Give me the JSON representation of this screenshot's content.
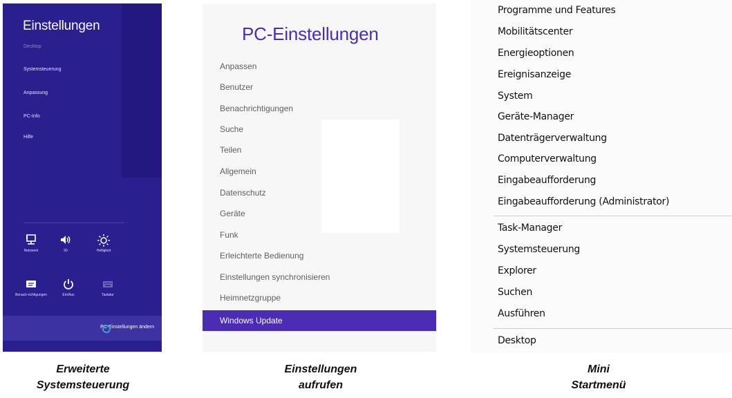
{
  "panel1": {
    "title": "Einstellungen",
    "subtitle": "Desktop",
    "items": [
      "Systemsteuerung",
      "Anpassung",
      "PC-Info",
      "Hilfe"
    ],
    "tiles": [
      {
        "icon": "network-icon",
        "label": "Netzwerk"
      },
      {
        "icon": "volume-icon",
        "label": "50"
      },
      {
        "icon": "brightness-icon",
        "label": "Helligkeit"
      },
      {
        "icon": "notifications-icon",
        "label": "Benach-richtigungen"
      },
      {
        "icon": "power-icon",
        "label": "Ein/Aus"
      },
      {
        "icon": "keyboard-icon",
        "label": "Tastatur"
      }
    ],
    "change_settings": "PC-Einstellungen ändern",
    "background": "#2a1f8f"
  },
  "panel2": {
    "title": "PC-Einstellungen",
    "items": [
      "Anpassen",
      "Benutzer",
      "Benachrichtigungen",
      "Suche",
      "Teilen",
      "Allgemein",
      "Datenschutz",
      "Geräte",
      "Funk",
      "Erleichterte Bedienung",
      "Einstellungen synchronisieren",
      "Heimnetzgruppe"
    ],
    "selected": "Windows Update",
    "accent": "#4b2db5"
  },
  "panel3": {
    "items": [
      "Programme und Features",
      "Mobilitätscenter",
      "Energieoptionen",
      "Ereignisanzeige",
      "System",
      "Geräte-Manager",
      "Datenträgerverwaltung",
      "Computerverwaltung",
      "Eingabeaufforderung",
      "Eingabeaufforderung (Administrator)",
      "Task-Manager",
      "Systemsteuerung",
      "Explorer",
      "Suchen",
      "Ausführen",
      "Desktop"
    ]
  },
  "captions": [
    {
      "line1": "Erweiterte",
      "line2": "Systemsteuerung"
    },
    {
      "line1": "Einstellungen",
      "line2": "aufrufen"
    },
    {
      "line1": "Mini",
      "line2": "Startmenü"
    }
  ]
}
